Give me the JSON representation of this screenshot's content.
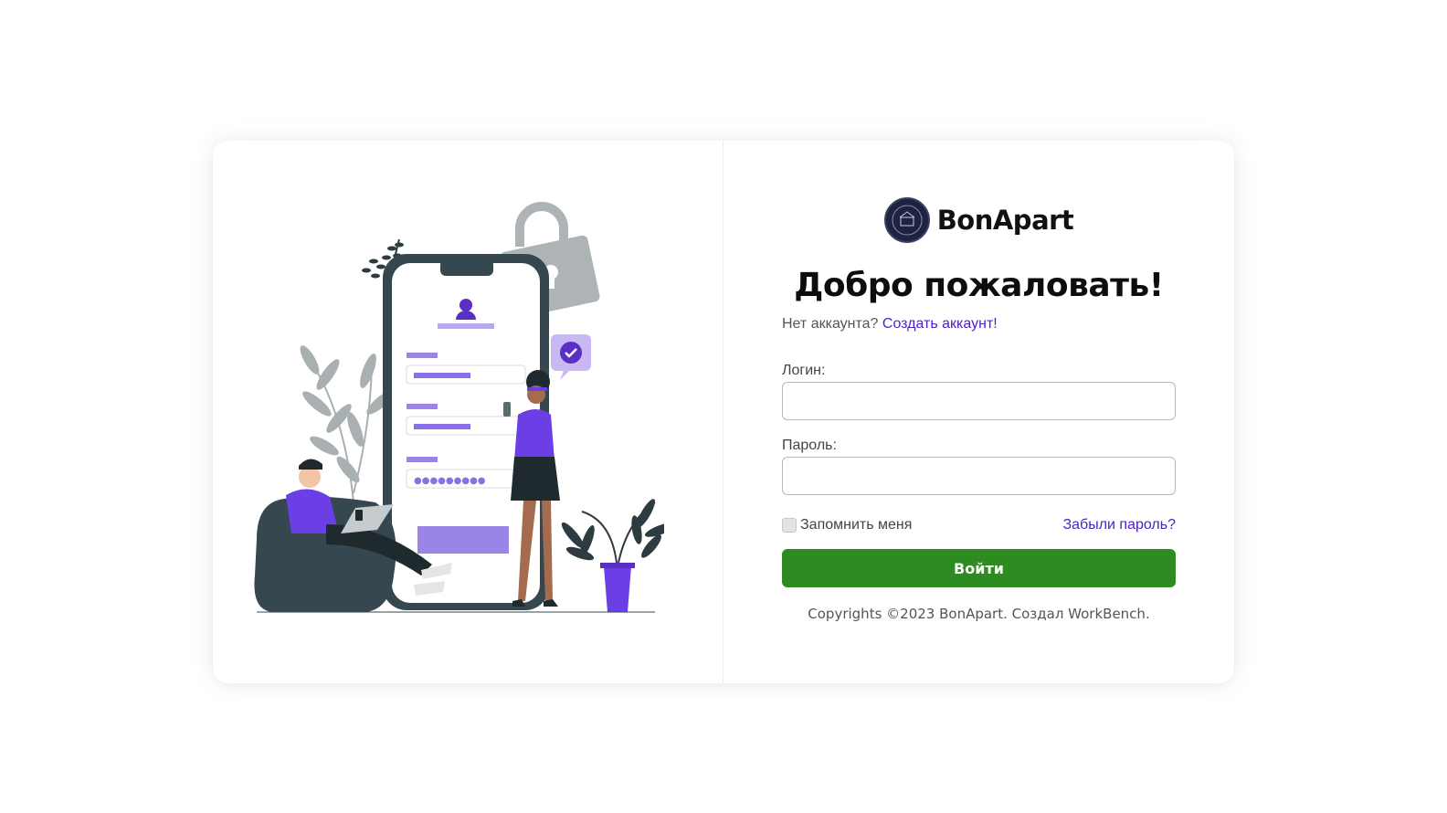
{
  "brand": {
    "name": "BonApart",
    "logo_icon": "bonapart-logo-seal-icon"
  },
  "login_form": {
    "title": "Добро пожаловать!",
    "no_account_text": "Нет аккаунта?",
    "create_account_link": "Создать аккаунт!",
    "login_label": "Логин:",
    "login_value": "",
    "password_label": "Пароль:",
    "password_value": "",
    "remember_label": "Запомнить меня",
    "remember_checked": false,
    "forgot_password_link": "Забыли пароль?",
    "submit_label": "Войти"
  },
  "footer": {
    "copyright": "Copyrights ©2023 BonApart. Создал WorkBench."
  },
  "illustration": {
    "icon": "login-illustration",
    "password_dots": "●●●●●●●●●"
  },
  "colors": {
    "accent_link": "#4a1fc7",
    "submit_button": "#2e8b22",
    "illustration_purple": "#6c3ee6",
    "illustration_dark": "#37474f"
  }
}
